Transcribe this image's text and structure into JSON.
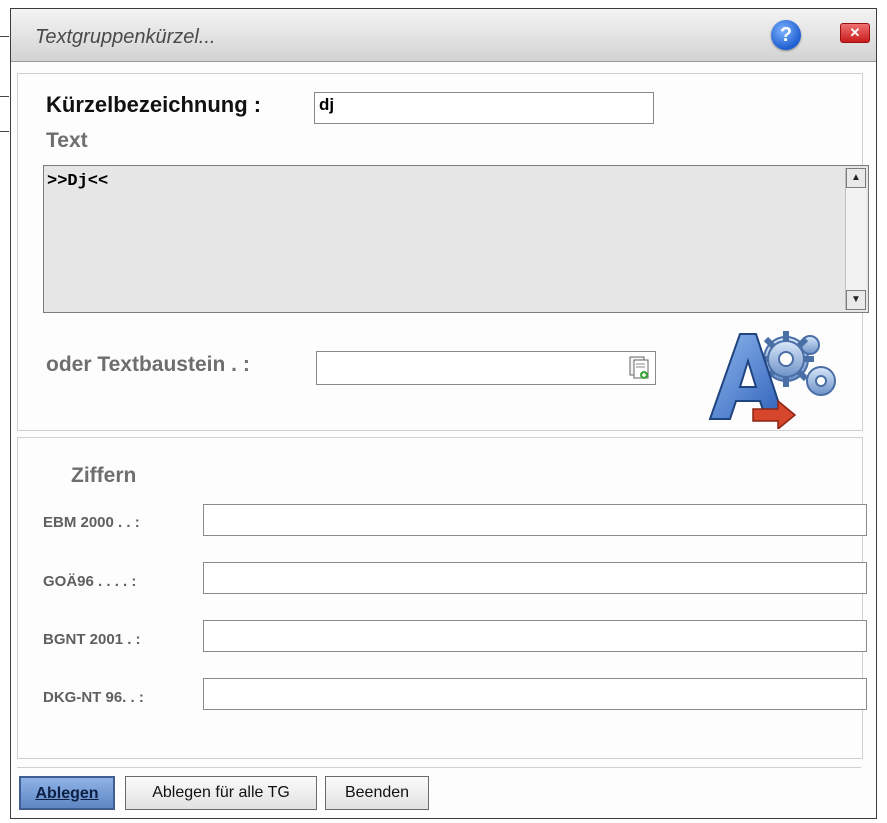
{
  "window": {
    "title": "Textgruppenkürzel...",
    "help_icon": "question-mark",
    "close_icon": "close-x"
  },
  "kuerzel": {
    "label": "Kürzelbezeichnung :",
    "value": "dj"
  },
  "text": {
    "label": "Text",
    "content": ">>Dj<<"
  },
  "textbaustein": {
    "label": "oder Textbaustein . :",
    "value": ""
  },
  "ziffern": {
    "label": "Ziffern",
    "rows": [
      {
        "label": "EBM 2000 . . :",
        "value": ""
      },
      {
        "label": "GOÄ96 . . . . :",
        "value": ""
      },
      {
        "label": "BGNT 2001  . :",
        "value": ""
      },
      {
        "label": "DKG-NT 96. . :",
        "value": ""
      }
    ]
  },
  "buttons": {
    "ablegen": "Ablegen",
    "ablegen_alle": "Ablegen für alle TG",
    "beenden": "Beenden"
  },
  "colors": {
    "accent_button": "#5e86c3",
    "textarea_bg": "#e6e6e6",
    "close_red": "#c81d1d",
    "help_blue": "#1d5fd0"
  }
}
